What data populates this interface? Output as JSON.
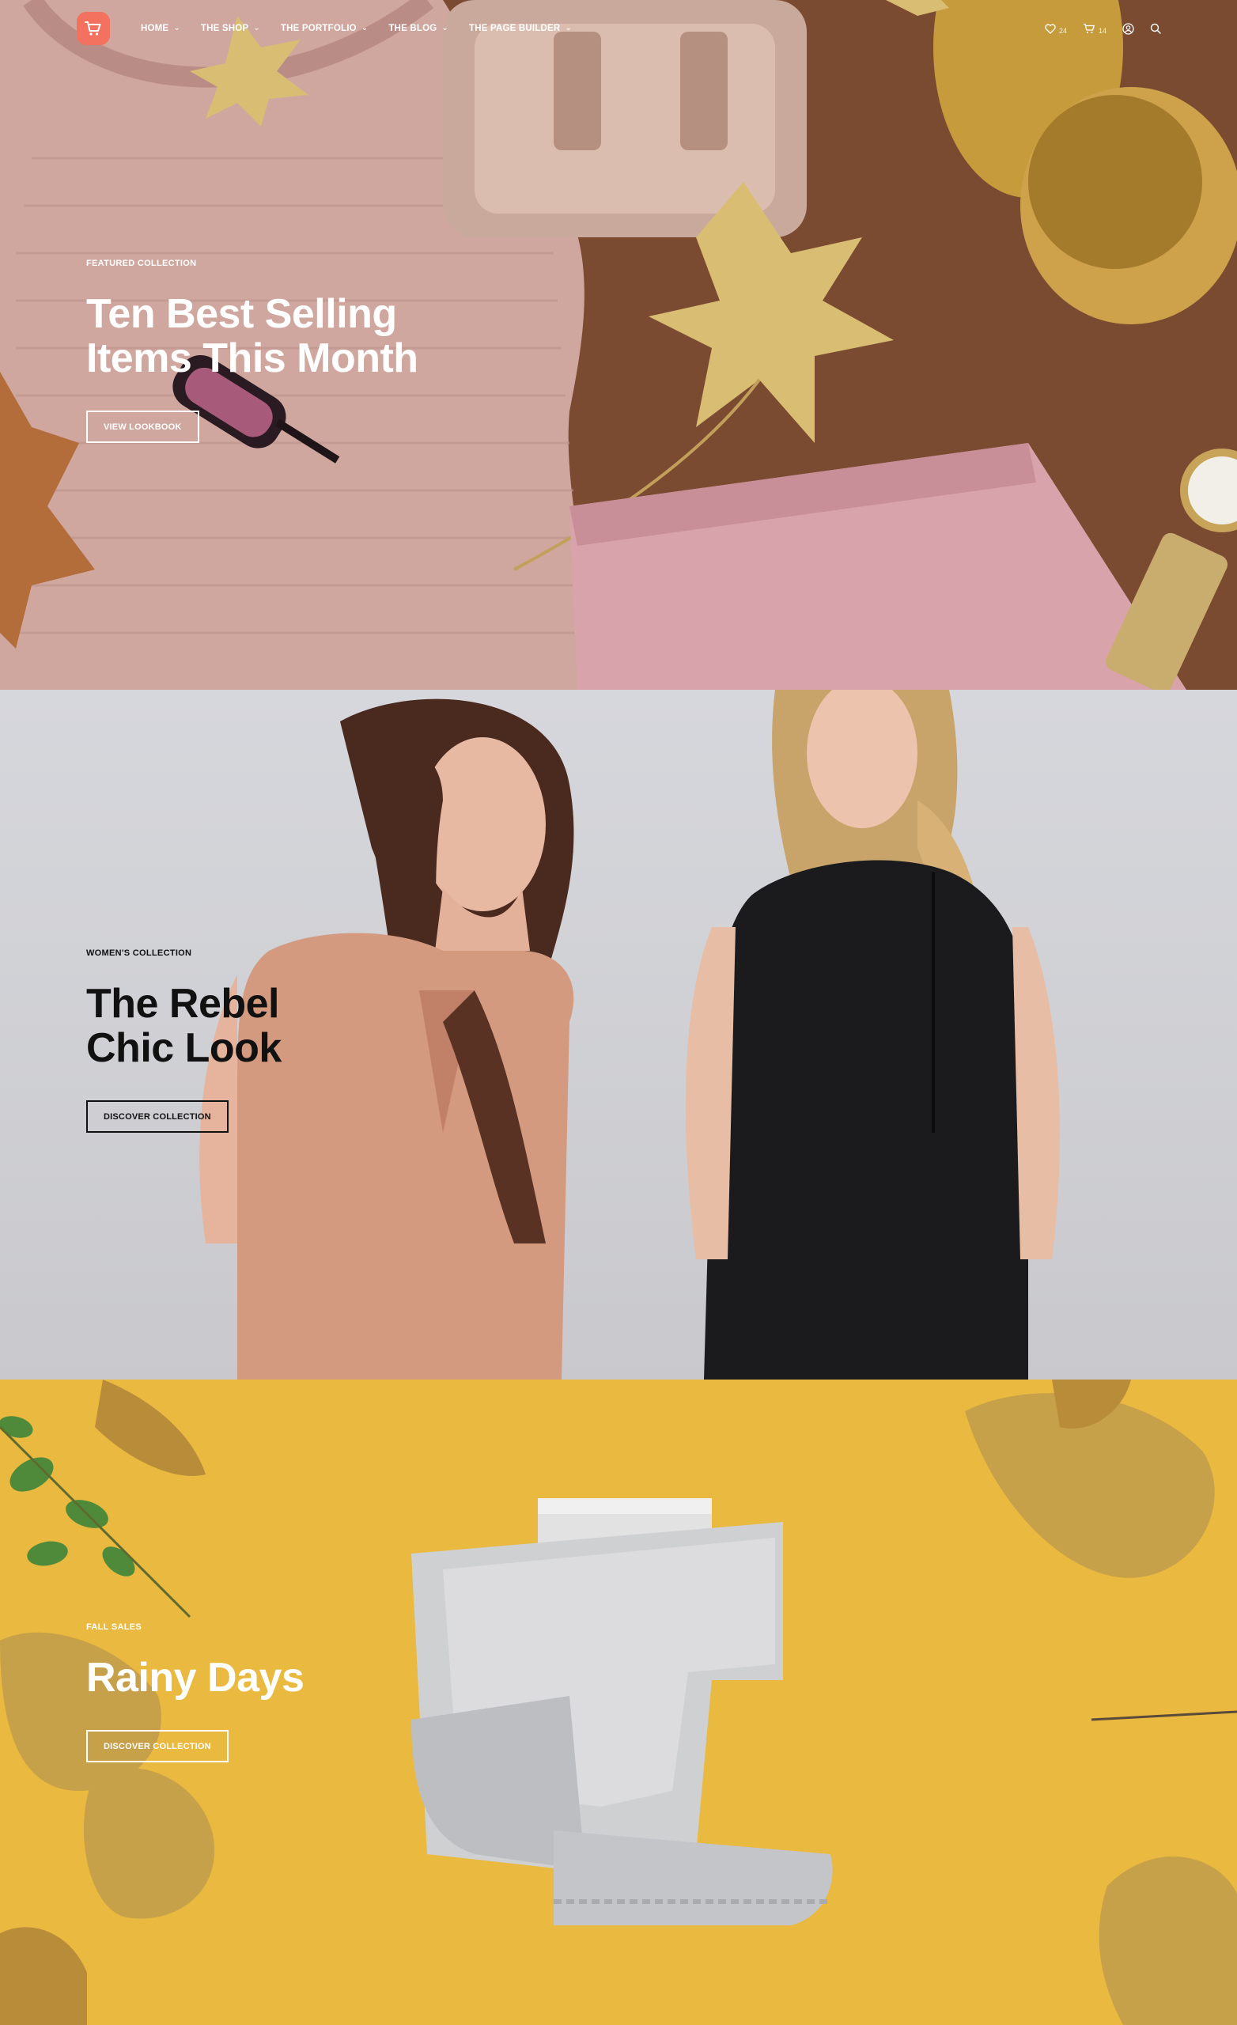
{
  "header": {
    "nav": [
      {
        "label": "HOME"
      },
      {
        "label": "THE SHOP"
      },
      {
        "label": "THE PORTFOLIO"
      },
      {
        "label": "THE BLOG"
      },
      {
        "label": "THE PAGE BUILDER"
      }
    ],
    "wishlist_count": "24",
    "cart_count": "14"
  },
  "slides": [
    {
      "kicker": "FEATURED COLLECTION",
      "title_line1": "Ten Best Selling",
      "title_line2": "Items This Month",
      "cta": "VIEW LOOKBOOK"
    },
    {
      "kicker": "WOMEN'S COLLECTION",
      "title_line1": "The Rebel",
      "title_line2": "Chic Look",
      "cta": "DISCOVER COLLECTION"
    },
    {
      "kicker": "FALL SALES",
      "title_line1": "Rainy Days",
      "cta": "DISCOVER COLLECTION"
    }
  ],
  "colors": {
    "accent": "#f2725f",
    "slide1_bg": "#7a4b32",
    "slide2_bg": "#d0d0d4",
    "slide3_bg": "#e9b93f"
  },
  "icons": [
    "cart-icon",
    "heart-icon",
    "cart-icon",
    "user-icon",
    "search-icon",
    "chevron-down-icon"
  ]
}
